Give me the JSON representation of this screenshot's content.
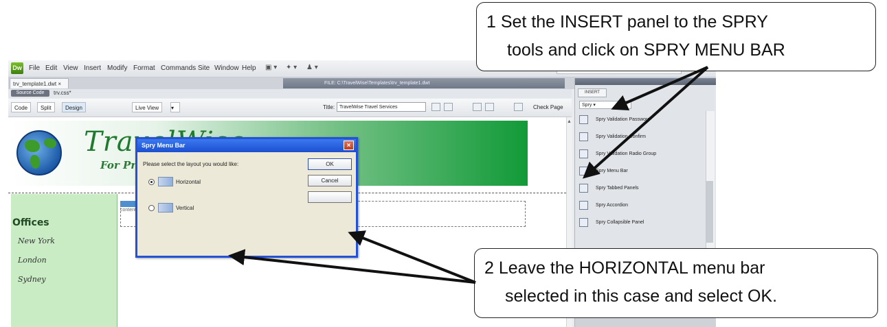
{
  "app": {
    "logo": "Dw",
    "menus": [
      "File",
      "Edit",
      "View",
      "Insert",
      "Modify",
      "Format",
      "Commands",
      "Site",
      "Window",
      "Help"
    ],
    "menu_icons": [
      "layout-icon",
      "extend-icon",
      "site-icon"
    ],
    "doc_tab": "trv_template1.dwt",
    "path_strip": "FILE: C:\\TravelWise\\Templates\\trv_template1.dwt",
    "related_files_chip": "Source Code",
    "related_files_label": "trv.css*"
  },
  "toolbar": {
    "code": "Code",
    "split": "Split",
    "design": "Design",
    "live_view": "Live View",
    "title_label": "Title:",
    "title_value": "TravelWise Travel Services",
    "check_page": "Check Page"
  },
  "page": {
    "site_title": "TravelWise",
    "tagline": "For Professional Travel Advice",
    "offices_heading": "Offices",
    "cities": [
      "New York",
      "London",
      "Sydney"
    ],
    "content_label": "content"
  },
  "dialog": {
    "title": "Spry Menu Bar",
    "prompt": "Please select the layout you would like:",
    "options": [
      {
        "label": "Horizontal",
        "selected": true
      },
      {
        "label": "Vertical",
        "selected": false
      }
    ],
    "ok": "OK",
    "cancel": "Cancel"
  },
  "panel": {
    "tab": "INSERT",
    "category": "Spry",
    "items": [
      "Spry Validation Password",
      "Spry Validation Confirm",
      "Spry Validation Radio Group",
      "Spry Menu Bar",
      "Spry Tabbed Panels",
      "Spry Accordion",
      "Spry Collapsible Panel"
    ]
  },
  "callouts": {
    "step1_line1": "1  Set the INSERT panel to the SPRY",
    "step1_line2": "tools and click on SPRY MENU BAR",
    "step2_line1": "2  Leave the HORIZONTAL menu bar",
    "step2_line2": "selected in this case and select OK."
  }
}
